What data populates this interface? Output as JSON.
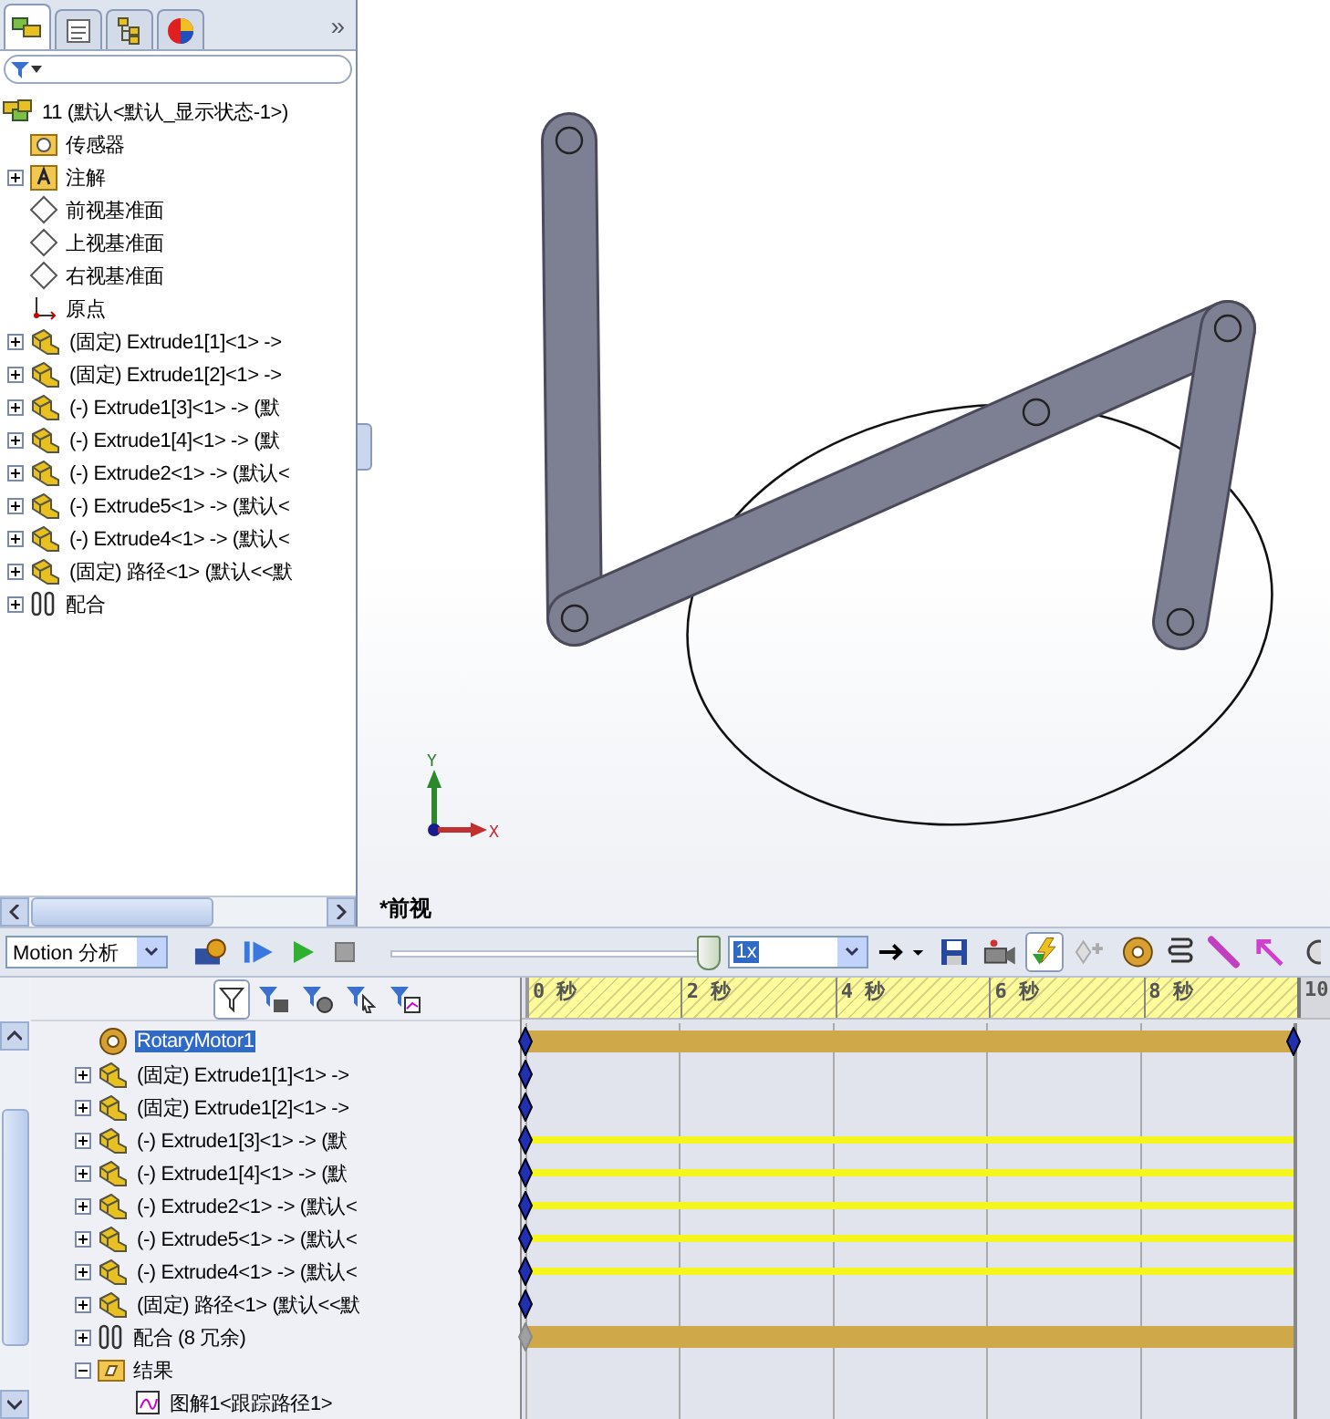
{
  "feature_tabs": {
    "tabs": [
      {
        "kind": "features",
        "selected": true
      },
      {
        "kind": "properties",
        "selected": false
      },
      {
        "kind": "configurations",
        "selected": false
      },
      {
        "kind": "display",
        "selected": false
      }
    ],
    "overflow": "»"
  },
  "feature_tree": {
    "root": {
      "kind": "assembly",
      "label": "11  (默认<默认_显示状态-1>)",
      "children": [
        {
          "kind": "sensor",
          "label": "传感器"
        },
        {
          "kind": "annotation",
          "label": "注解",
          "expanded": false
        },
        {
          "kind": "plane",
          "label": "前视基准面"
        },
        {
          "kind": "plane",
          "label": "上视基准面"
        },
        {
          "kind": "plane",
          "label": "右视基准面"
        },
        {
          "kind": "origin",
          "label": "原点"
        },
        {
          "kind": "part",
          "label": "(固定) Extrude1[1]<1> ->",
          "expanded": false
        },
        {
          "kind": "part",
          "label": "(固定) Extrude1[2]<1> ->",
          "expanded": false
        },
        {
          "kind": "part",
          "label": "(-) Extrude1[3]<1> -> (默",
          "expanded": false
        },
        {
          "kind": "part",
          "label": "(-) Extrude1[4]<1> -> (默",
          "expanded": false
        },
        {
          "kind": "part",
          "label": "(-) Extrude2<1> -> (默认<",
          "expanded": false
        },
        {
          "kind": "part",
          "label": "(-) Extrude5<1> -> (默认<",
          "expanded": false
        },
        {
          "kind": "part",
          "label": "(-) Extrude4<1> -> (默认<",
          "expanded": false
        },
        {
          "kind": "part",
          "label": "(固定) 路径<1> (默认<<默",
          "expanded": false
        },
        {
          "kind": "mates",
          "label": "配合",
          "expanded": false
        }
      ]
    }
  },
  "graphics": {
    "view_name": "*前视",
    "axis_x": "X",
    "axis_y": "Y"
  },
  "motion_toolbar": {
    "study_type": "Motion 分析",
    "playback": {
      "level": 0.97
    },
    "speed": "1x",
    "tools": [
      {
        "kind": "calculate",
        "pressed": false
      },
      {
        "kind": "play_start",
        "pressed": false
      },
      {
        "kind": "play",
        "pressed": false
      },
      {
        "kind": "stop",
        "pressed": false
      }
    ],
    "tools_right": [
      {
        "kind": "playback_mode",
        "pressed": false
      },
      {
        "kind": "save",
        "pressed": false
      },
      {
        "kind": "camera",
        "pressed": false
      },
      {
        "kind": "autokey",
        "pressed": true
      },
      {
        "kind": "add_key",
        "pressed": false
      },
      {
        "kind": "motor",
        "pressed": false
      },
      {
        "kind": "spring",
        "pressed": false
      },
      {
        "kind": "damper",
        "pressed": false
      },
      {
        "kind": "force",
        "pressed": false
      },
      {
        "kind": "contact",
        "pressed": false
      }
    ]
  },
  "motion_filters": [
    {
      "kind": "filter",
      "pressed": true
    },
    {
      "kind": "filter_animated",
      "pressed": false
    },
    {
      "kind": "filter_driving",
      "pressed": false
    },
    {
      "kind": "filter_selected",
      "pressed": false
    },
    {
      "kind": "filter_results",
      "pressed": false
    }
  ],
  "motion_tree": [
    {
      "kind": "motor",
      "label": "RotaryMotor1",
      "selected": true,
      "bar": true,
      "key_start": true,
      "key_end": true
    },
    {
      "kind": "part",
      "label": "(固定) Extrude1[1]<1> ->",
      "selected": false,
      "expanded": false,
      "key_start": true
    },
    {
      "kind": "part",
      "label": "(固定) Extrude1[2]<1> ->",
      "selected": false,
      "expanded": false,
      "key_start": true
    },
    {
      "kind": "part",
      "label": "(-) Extrude1[3]<1> -> (默",
      "selected": false,
      "expanded": false,
      "moving": true,
      "key_start": true
    },
    {
      "kind": "part",
      "label": "(-) Extrude1[4]<1> -> (默",
      "selected": false,
      "expanded": false,
      "moving": true,
      "key_start": true
    },
    {
      "kind": "part",
      "label": "(-) Extrude2<1> -> (默认<",
      "selected": false,
      "expanded": false,
      "moving": true,
      "key_start": true
    },
    {
      "kind": "part",
      "label": "(-) Extrude5<1> -> (默认<",
      "selected": false,
      "expanded": false,
      "moving": true,
      "key_start": true
    },
    {
      "kind": "part",
      "label": "(-) Extrude4<1> -> (默认<",
      "selected": false,
      "expanded": false,
      "moving": true,
      "key_start": true
    },
    {
      "kind": "part",
      "label": "(固定) 路径<1> (默认<<默",
      "selected": false,
      "expanded": false,
      "key_start": true
    },
    {
      "kind": "mates",
      "label": "配合 (8 冗余)",
      "selected": false,
      "expanded": false,
      "bar": true,
      "key_suppressed": true
    },
    {
      "kind": "folder",
      "label": "结果",
      "selected": false,
      "expanded": true,
      "children": [
        {
          "kind": "plot",
          "label": "图解1<跟踪路径1>",
          "selected": false
        }
      ]
    }
  ],
  "timeline": {
    "ticks": [
      "0 秒",
      "2 秒",
      "4 秒",
      "6 秒",
      "8 秒",
      "10"
    ]
  }
}
